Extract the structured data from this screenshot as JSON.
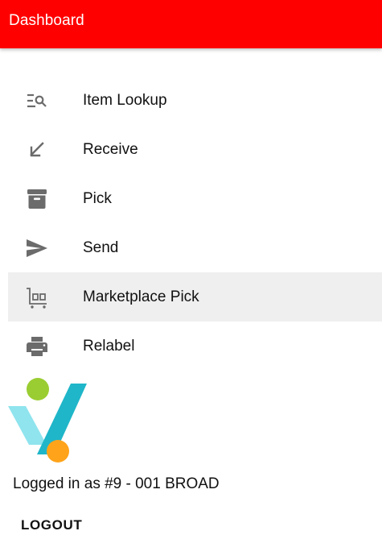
{
  "app_bar": {
    "title": "Dashboard",
    "background": "#ff0000"
  },
  "menu": {
    "items": [
      {
        "label": "Item Lookup",
        "icon": "item-lookup-icon",
        "active": false
      },
      {
        "label": "Receive",
        "icon": "arrow-down-left-icon",
        "active": false
      },
      {
        "label": "Pick",
        "icon": "archive-box-icon",
        "active": false
      },
      {
        "label": "Send",
        "icon": "send-icon",
        "active": false
      },
      {
        "label": "Marketplace Pick",
        "icon": "cart-icon",
        "active": true
      },
      {
        "label": "Relabel",
        "icon": "printer-icon",
        "active": false
      }
    ],
    "active_background": "#efefef",
    "icon_color": "#6b6b6b"
  },
  "logo": {
    "colors": {
      "teal": "#22c3d6",
      "green": "#9acd32",
      "orange": "#ffa31a"
    }
  },
  "footer": {
    "logged_in_text": "Logged in as #9 - 001 BROAD",
    "logout_label": "LOGOUT"
  }
}
